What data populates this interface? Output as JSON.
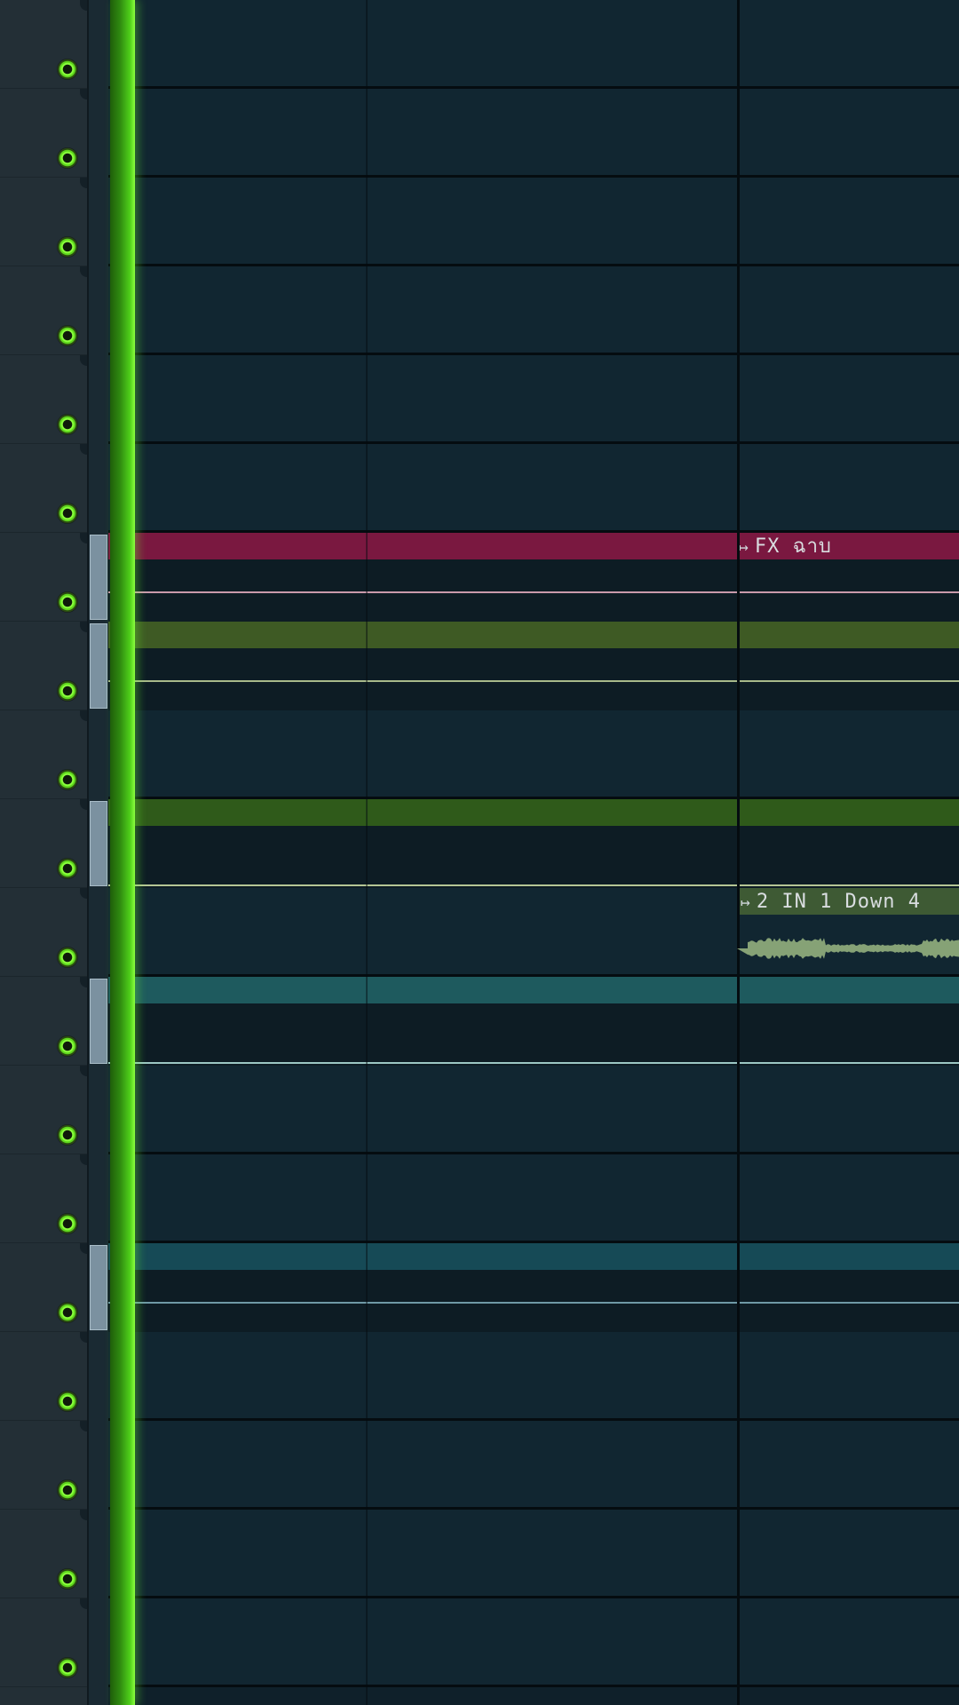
{
  "app": "FL Studio Playlist",
  "colors": {
    "background": "#112631",
    "header": "#232f36",
    "playhead": "#4fd01a",
    "mute_led": "#8aff3c",
    "fx_clip": "#7a1840",
    "olive_clip": "#3e5a24",
    "green_clip": "#2f5a1a",
    "teal_clip": "#1e5a5e",
    "teal_dark_clip": "#164a56",
    "audio_clip": "#4a6a3a"
  },
  "tracks": {
    "count": 19,
    "mute_icon": "circle-led-icon"
  },
  "clips": {
    "fx": {
      "label": "FX ฉาบ",
      "icon": "arrow-right-bar-icon"
    },
    "audio": {
      "label": "2 IN 1 Down 4",
      "icon": "arrow-right-bar-icon"
    }
  }
}
